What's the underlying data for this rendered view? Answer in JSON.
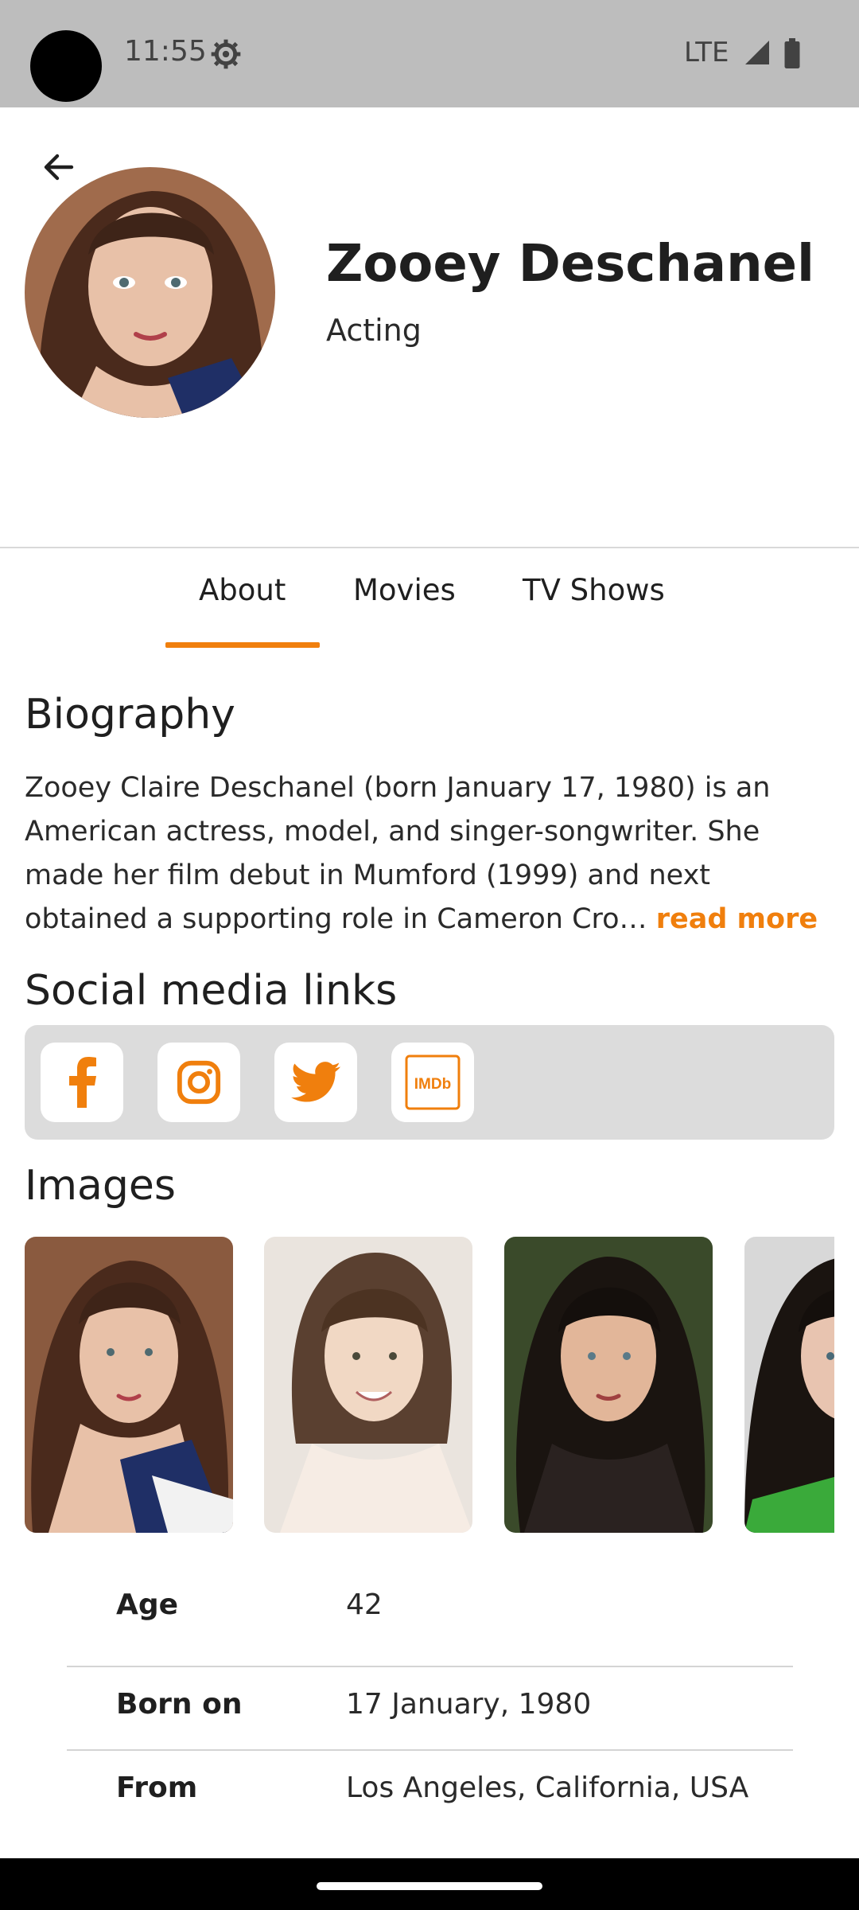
{
  "status_bar": {
    "time": "11:55",
    "network": "LTE"
  },
  "profile": {
    "name": "Zooey Deschanel",
    "department": "Acting"
  },
  "tabs": [
    {
      "label": "About"
    },
    {
      "label": "Movies"
    },
    {
      "label": "TV Shows"
    }
  ],
  "selected_tab": "About",
  "biography": {
    "title": "Biography",
    "text": "Zooey Claire Deschanel (born January 17, 1980) is an American actress, model, and singer-songwriter. She made her film debut in Mumford (1999) and next obtained a supporting role in Cameron Cro…",
    "read_more": "read more"
  },
  "social": {
    "title": "Social media links",
    "links": [
      {
        "icon": "facebook-icon"
      },
      {
        "icon": "instagram-icon"
      },
      {
        "icon": "twitter-icon"
      },
      {
        "icon": "imdb-icon",
        "text": "IMDb"
      }
    ]
  },
  "images": {
    "title": "Images"
  },
  "info": [
    {
      "label": "Age",
      "value": "42"
    },
    {
      "label": "Born on",
      "value": "17 January, 1980"
    },
    {
      "label": "From",
      "value": "Los Angeles, California, USA"
    }
  ],
  "colors": {
    "accent": "#f07f0d",
    "status_bar": "#bdbdbd",
    "social_panel": "#dcdcdc"
  }
}
